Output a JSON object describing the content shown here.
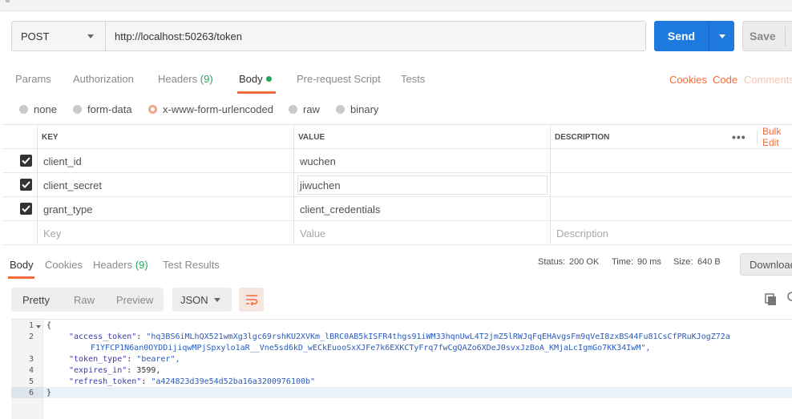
{
  "request": {
    "method": "POST",
    "url": "http://localhost:50263/token",
    "send_label": "Send",
    "save_label": "Save"
  },
  "request_tabs": [
    {
      "label": "Params"
    },
    {
      "label": "Authorization"
    },
    {
      "label": "Headers",
      "count": "(9)"
    },
    {
      "label": "Body"
    },
    {
      "label": "Pre-request Script"
    },
    {
      "label": "Tests"
    }
  ],
  "request_links": {
    "cookies": "Cookies",
    "code": "Code",
    "comments": "Comments"
  },
  "body_types": [
    "none",
    "form-data",
    "x-www-form-urlencoded",
    "raw",
    "binary"
  ],
  "selected_body_type": "x-www-form-urlencoded",
  "params_table": {
    "headers": {
      "key": "KEY",
      "value": "VALUE",
      "description": "DESCRIPTION",
      "bulk_edit": "Bulk Edit"
    },
    "rows": [
      {
        "key": "client_id",
        "value": "wuchen",
        "checked": true
      },
      {
        "key": "client_secret",
        "value": "jiwuchen",
        "checked": true
      },
      {
        "key": "grant_type",
        "value": "client_credentials",
        "checked": true
      }
    ],
    "placeholders": {
      "key": "Key",
      "value": "Value",
      "description": "Description"
    }
  },
  "response_tabs": [
    {
      "label": "Body"
    },
    {
      "label": "Cookies"
    },
    {
      "label": "Headers",
      "count": "(9)"
    },
    {
      "label": "Test Results"
    }
  ],
  "response_meta": {
    "status_label": "Status:",
    "status_value": "200 OK",
    "time_label": "Time:",
    "time_value": "90 ms",
    "size_label": "Size:",
    "size_value": "640 B",
    "download_label": "Download"
  },
  "viewer": {
    "modes": [
      "Pretty",
      "Raw",
      "Preview"
    ],
    "active_mode": "Pretty",
    "format": "JSON"
  },
  "code": {
    "line_numbers": [
      "1",
      "2",
      "3",
      "4",
      "5",
      "6"
    ],
    "open_brace": "{",
    "close_brace": "}",
    "access_token_key": "\"access_token\"",
    "access_token_value_1": "\"hq3BS6iMLhQX521wmXg3lgc69rshKU2XVKm_lBRC0AB5kISFR4thgs91iWM33hqnUwL4T2jmZ5lRWJqFqEHAvgsFm9qVeI8zxBS44Fu81CsCfPRuKJogZ72a",
    "access_token_value_2": "F1YFCP1N6an0OYDDijiqwMPjSpxylo1aR__Vne5sd6kD_wECkEuooSxXJFe7k6EXKCTyFrq7fwCgQAZo6XDeJ0svxJzBoA_KMjaLcIgmGo7KK34IwM\",",
    "token_type_key": "\"token_type\"",
    "token_type_value": "\"bearer\",",
    "expires_in_key": "\"expires_in\"",
    "expires_in_value": "3599,",
    "refresh_token_key": "\"refresh_token\"",
    "refresh_token_value": "\"a424823d39e54d52ba16a3200976100b\""
  },
  "colors": {
    "accent": "#f26b3a",
    "send": "#1f7ae0",
    "success": "#26a55a"
  }
}
